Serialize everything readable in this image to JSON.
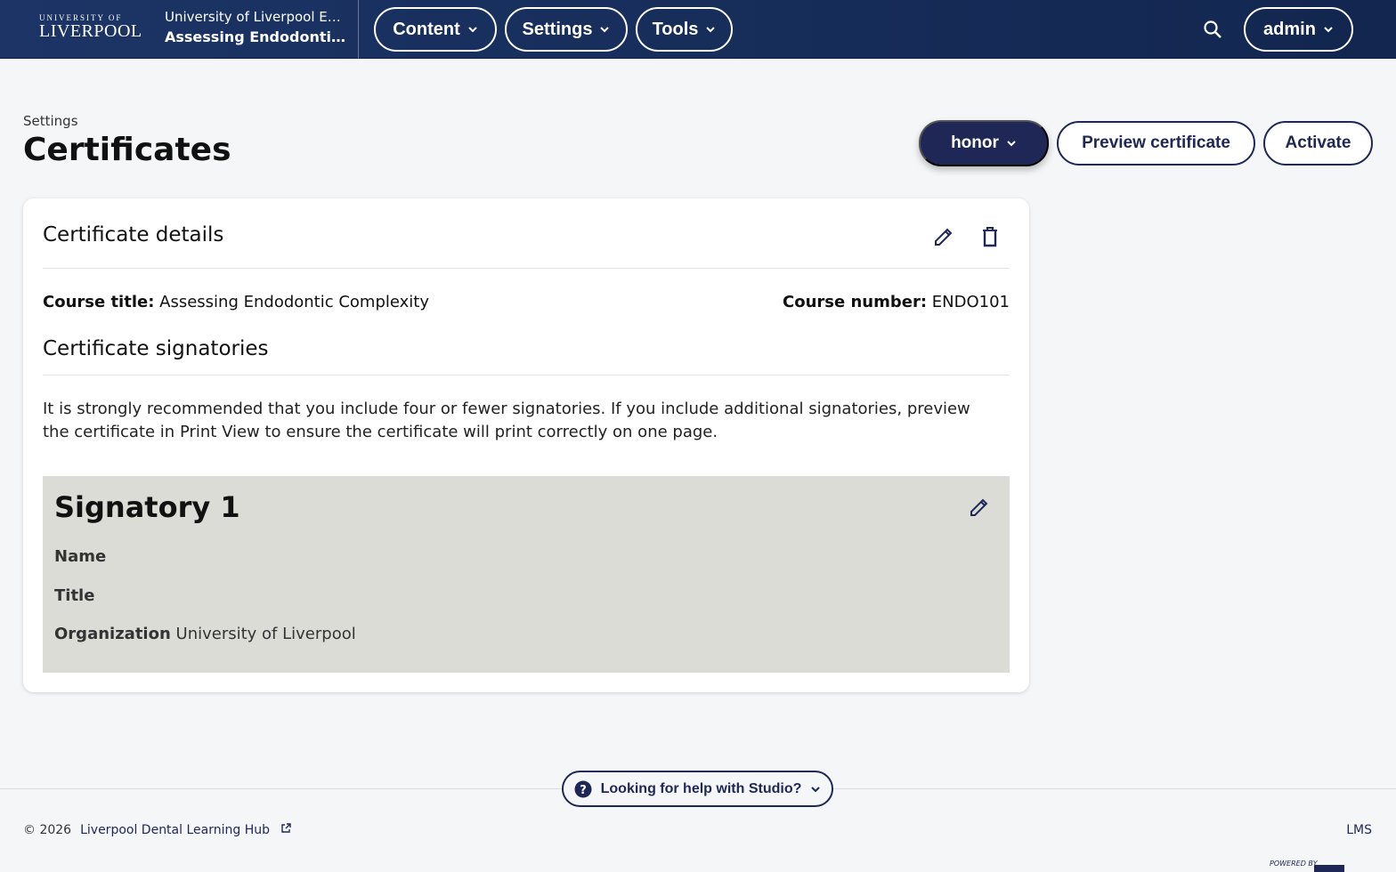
{
  "header": {
    "logo_small": "UNIVERSITY OF",
    "logo_big": "LIVERPOOL",
    "org_name": "University of Liverpool EN...",
    "course_name": "Assessing Endodonti...",
    "nav": {
      "content": "Content",
      "settings": "Settings",
      "tools": "Tools"
    },
    "user": "admin"
  },
  "page": {
    "breadcrumb": "Settings",
    "title": "Certificates",
    "mode_label": "honor",
    "preview_label": "Preview certificate",
    "activate_label": "Activate"
  },
  "card": {
    "title": "Certificate details",
    "course_title_label": "Course title:",
    "course_title_value": "Assessing Endodontic Complexity",
    "course_number_label": "Course number:",
    "course_number_value": "ENDO101",
    "signatories_title": "Certificate signatories",
    "recommendation": "It is strongly recommended that you include four or fewer signatories. If you include additional signatories, preview the certificate in Print View to ensure the certificate will print correctly on one page.",
    "signatory": {
      "title": "Signatory 1",
      "name_label": "Name",
      "name_value": "",
      "title_label": "Title",
      "title_value": "",
      "org_label": "Organization",
      "org_value": "University of Liverpool"
    }
  },
  "footer": {
    "help_label": "Looking for help with Studio?",
    "copyright": "© 2026",
    "hub_link": "Liverpool Dental Learning Hub",
    "lms_link": "LMS",
    "powered_by": "POWERED BY"
  },
  "colors": {
    "header_bg": "#1c3566",
    "primary": "#1e2755",
    "page_bg": "#f4f6f8",
    "signatory_bg": "#dcdcd7"
  }
}
